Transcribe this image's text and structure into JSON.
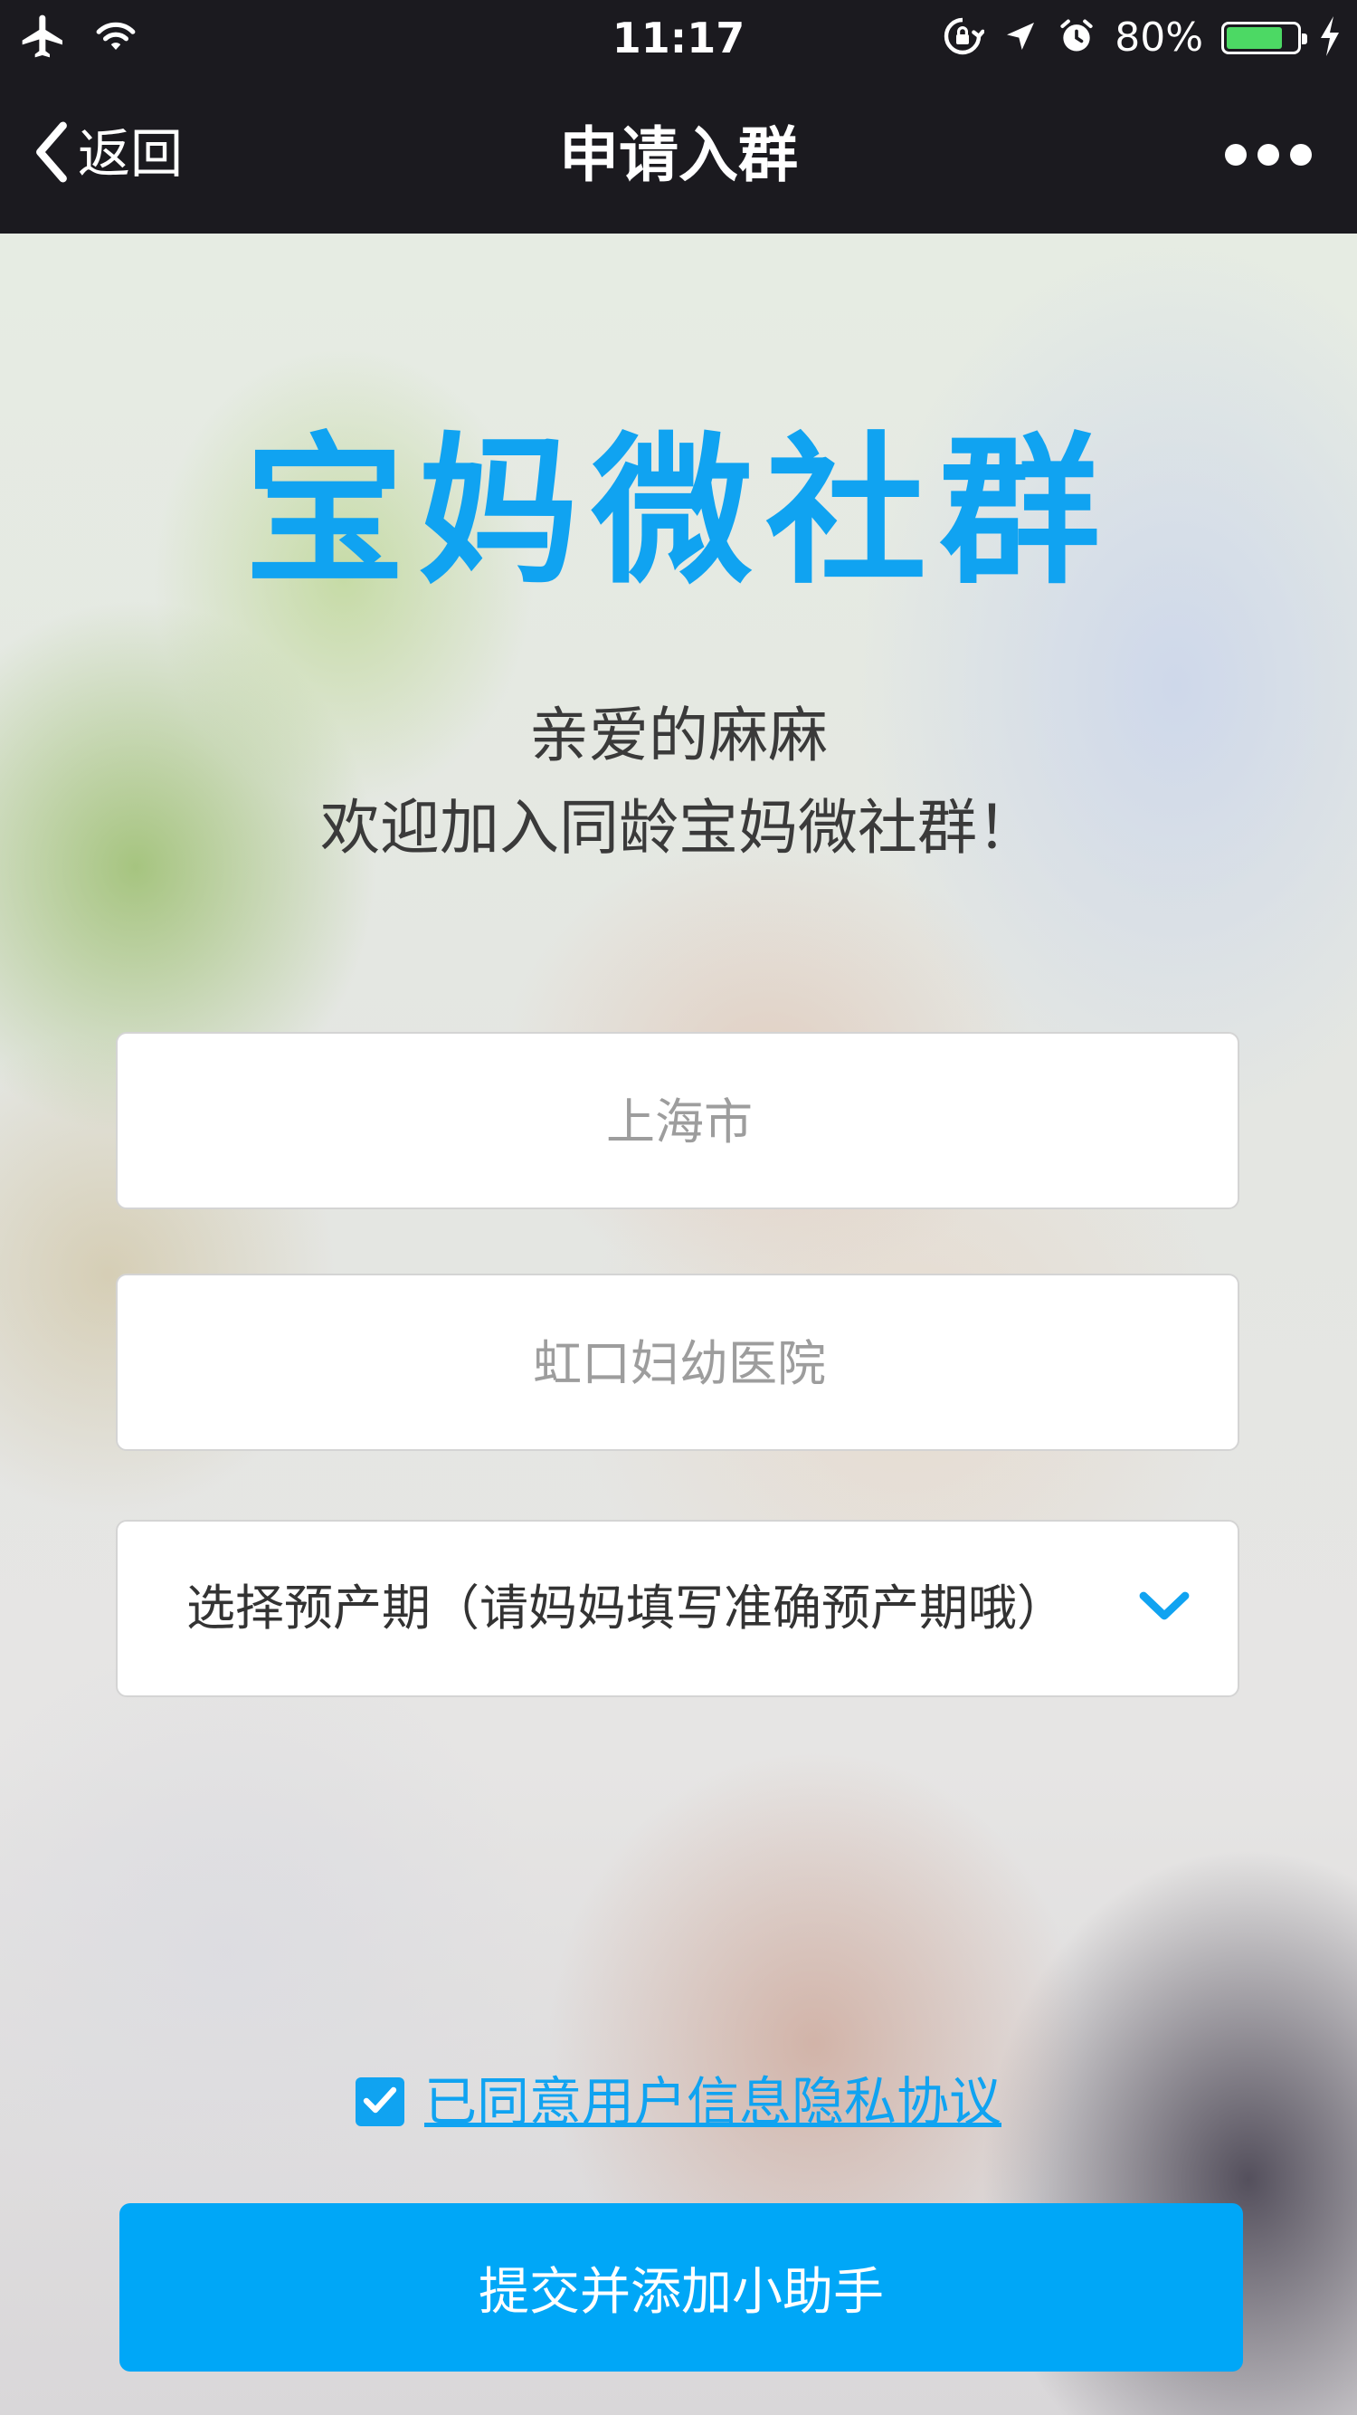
{
  "status_bar": {
    "time": "11:17",
    "battery_percent": "80%",
    "battery_level": 0.8,
    "icons": [
      "airplane-icon",
      "wifi-icon",
      "rotation-lock-icon",
      "location-arrow-icon",
      "alarm-icon",
      "battery-icon",
      "charging-bolt-icon"
    ]
  },
  "nav": {
    "back_label": "返回",
    "title": "申请入群",
    "more_icon": "more-dots-icon"
  },
  "main": {
    "brand_title": "宝妈微社群",
    "welcome_line1": "亲爱的麻麻",
    "welcome_line2": "欢迎加入同龄宝妈微社群！",
    "city_field": {
      "value": "",
      "placeholder": "上海市"
    },
    "hospital_field": {
      "value": "",
      "placeholder": "虹口妇幼医院"
    },
    "due_date_select": {
      "label": "选择预产期（请妈妈填写准确预产期哦）",
      "icon": "chevron-down-icon"
    },
    "agreement": {
      "checked": true,
      "label": "已同意用户信息隐私协议"
    },
    "submit_label": "提交并添加小助手"
  },
  "colors": {
    "accent": "#10a3f1",
    "button": "#00a7f7",
    "bar_background": "#1b1a1f",
    "battery_green": "#4cd964"
  }
}
